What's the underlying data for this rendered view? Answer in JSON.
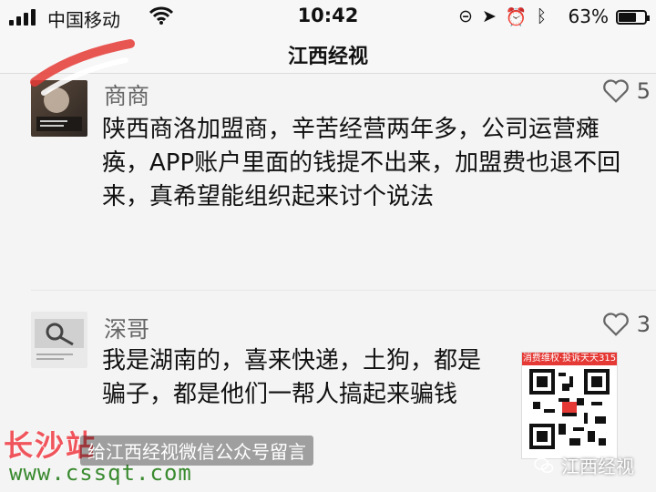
{
  "status_bar": {
    "carrier": "中国移动",
    "time": "10:42",
    "battery_percent": "63%",
    "battery_level": 0.63,
    "icons": [
      "lock-rotation-icon",
      "location-icon",
      "alarm-icon",
      "bluetooth-icon"
    ]
  },
  "nav": {
    "title": "江西经视"
  },
  "comments": [
    {
      "name": "商商",
      "likes": "5",
      "text": "陕西商洛加盟商，辛苦经营两年多，公司运营瘫痪，APP账户里面的钱提不出来，加盟费也退不回来，真希望能组织起来讨个说法"
    },
    {
      "name": "深哥",
      "likes": "3",
      "text": "我是湖南的，喜来快递，土狗，都是骗子，都是他们一帮人搞起来骗钱"
    }
  ],
  "overlay": {
    "watermark_site": "长沙站",
    "watermark_url": "www.cssqt.com",
    "subtitle": "给江西经视微信公众号留言",
    "qr_label": "消费维权·投诉天天315",
    "brand": "江西经视"
  },
  "colors": {
    "accent_red": "#e53935",
    "watermark_green": "#3a8a30"
  }
}
